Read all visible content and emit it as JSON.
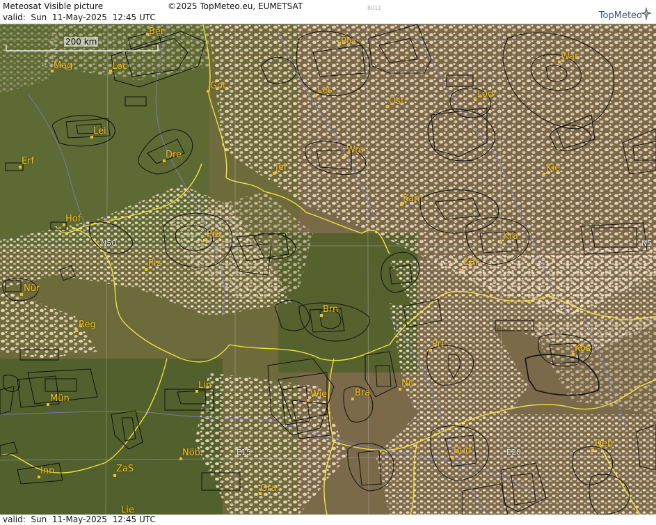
{
  "header": {
    "title": "Meteosat Visible picture",
    "copyright": "©2025 TopMeteo.eu, EUMETSAT",
    "valid": "valid:  Sun  11-May-2025  12:45 UTC",
    "code": "8011",
    "logo_text": "TopMeteo"
  },
  "footer": {
    "valid": "valid:  Sun  11-May-2025  12:45 UTC"
  },
  "scale": {
    "label": "200 km"
  },
  "colors": {
    "city_label": "#f0c020",
    "border": "#f2e23a",
    "river": "#7f7fd0",
    "grid": "#b0b0b0",
    "outline": "#111111"
  },
  "cities": [
    {
      "id": "ber",
      "name": "Ber"
    },
    {
      "id": "poz",
      "name": "Poz"
    },
    {
      "id": "war",
      "name": "War"
    },
    {
      "id": "mag",
      "name": "Mag"
    },
    {
      "id": "loc",
      "name": "Loc"
    },
    {
      "id": "got",
      "name": "Got"
    },
    {
      "id": "les",
      "name": "Les"
    },
    {
      "id": "ost",
      "name": "Ost"
    },
    {
      "id": "lod",
      "name": "Lod"
    },
    {
      "id": "lei",
      "name": "Lei"
    },
    {
      "id": "dre",
      "name": "Dre"
    },
    {
      "id": "wro",
      "name": "Wro"
    },
    {
      "id": "erf",
      "name": "Erf"
    },
    {
      "id": "jel",
      "name": "Jel"
    },
    {
      "id": "kie",
      "name": "Kie"
    },
    {
      "id": "kam",
      "name": "Kam"
    },
    {
      "id": "hof",
      "name": "Hof"
    },
    {
      "id": "pra",
      "name": "Pra"
    },
    {
      "id": "kra",
      "name": "Kra"
    },
    {
      "id": "plz",
      "name": "Plz"
    },
    {
      "id": "zar",
      "name": "Zar"
    },
    {
      "id": "nur",
      "name": "Nür"
    },
    {
      "id": "brn",
      "name": "Brn"
    },
    {
      "id": "reg",
      "name": "Reg"
    },
    {
      "id": "pri",
      "name": "Pri"
    },
    {
      "id": "kos",
      "name": "Kos"
    },
    {
      "id": "lin",
      "name": "Lin"
    },
    {
      "id": "nit",
      "name": "Nit"
    },
    {
      "id": "wie",
      "name": "Wie"
    },
    {
      "id": "bra",
      "name": "Bra"
    },
    {
      "id": "mun",
      "name": "Mün"
    },
    {
      "id": "nob",
      "name": "Nöb"
    },
    {
      "id": "bud",
      "name": "Bud"
    },
    {
      "id": "deb",
      "name": "Deb"
    },
    {
      "id": "inn",
      "name": "Inn"
    },
    {
      "id": "zas",
      "name": "ZaS"
    },
    {
      "id": "gra",
      "name": "Gra"
    },
    {
      "id": "lie",
      "name": "Lie"
    }
  ],
  "coords": {
    "n50_left": "N50",
    "n50_right": "N5",
    "e15": "E15",
    "e20": "E20"
  }
}
